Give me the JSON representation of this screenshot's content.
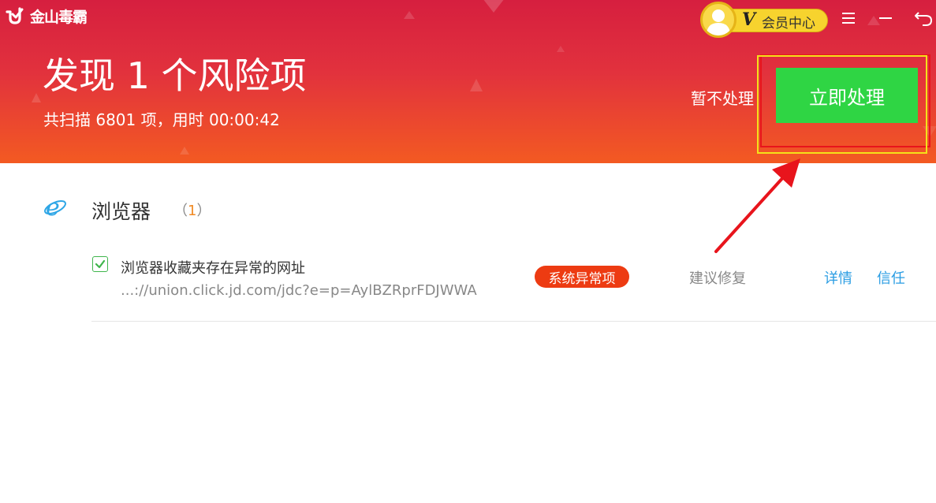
{
  "app": {
    "name": "金山毒霸"
  },
  "vip": {
    "badge": "V",
    "label": "会员中心"
  },
  "icons": {
    "menu": "menu-icon",
    "minimize": "minimize-icon",
    "back": "back-icon",
    "browser": "ie-browser-icon",
    "check": "check-icon"
  },
  "header": {
    "title": "发现 1 个风险项",
    "subtitle": "共扫描 6801 项，用时 00:00:42",
    "skip_label": "暂不处理",
    "fix_label": "立即处理"
  },
  "category": {
    "name": "浏览器",
    "count_open": "（",
    "count": "1",
    "count_close": "）"
  },
  "items": [
    {
      "title": "浏览器收藏夹存在异常的网址",
      "url": "...://union.click.jd.com/jdc?e=p=AylBZRprFDJWWA1",
      "badge": "系统异常项",
      "suggestion": "建议修复",
      "detail_label": "详情",
      "trust_label": "信任",
      "checked": true
    }
  ],
  "colors": {
    "header_top": "#d61f3f",
    "header_bottom": "#f35a22",
    "fix_button": "#2fd544",
    "badge": "#ed3b12",
    "link": "#2a9de3",
    "annotation_red": "#e8141c",
    "annotation_yellow": "#f4e11a"
  }
}
